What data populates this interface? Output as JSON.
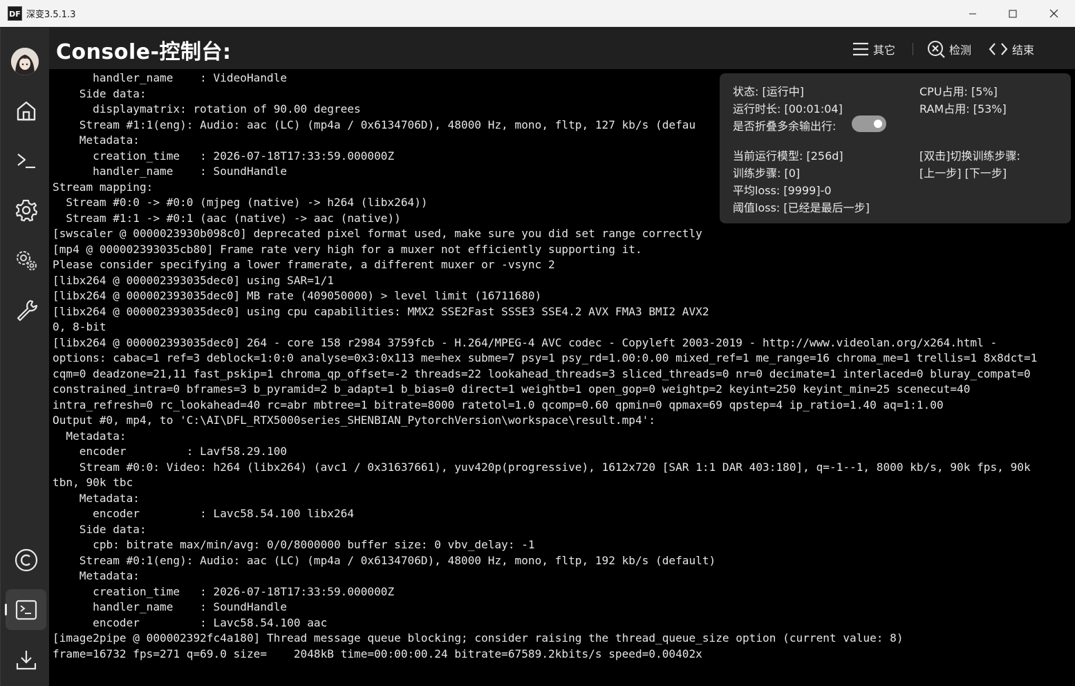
{
  "window": {
    "title": "深变3.5.1.3",
    "app_icon_text": "DF"
  },
  "sidebar": {
    "items": [
      {
        "name": "home-icon"
      },
      {
        "name": "terminal-prompt-icon"
      },
      {
        "name": "gear-icon"
      },
      {
        "name": "multi-gear-icon"
      },
      {
        "name": "wrench-icon"
      },
      {
        "name": "copyright-icon"
      },
      {
        "name": "console-icon",
        "active": true
      },
      {
        "name": "download-icon"
      }
    ]
  },
  "header": {
    "title": "Console-控制台:",
    "buttons": {
      "other": "其它",
      "detect": "检测",
      "end": "结束"
    }
  },
  "status_panel": {
    "state": "状态: [运行中]",
    "cpu": "CPU占用: [5%]",
    "runtime": "运行时长: [00:01:04]",
    "ram": "RAM占用: [53%]",
    "fold_label": "是否折叠多余输出行:",
    "fold_enabled": true,
    "model": "当前运行模型: [256d]",
    "switch_hint": "[双击]切换训练步骤:",
    "steps": "训练步骤: [0]",
    "step_nav": "[上一步] [下一步]",
    "avg_loss": "平均loss: [9999]-0",
    "threshold_loss": "阈值loss: [已经是最后一步]"
  },
  "console": {
    "lines": [
      "      handler_name    : VideoHandle",
      "    Side data:",
      "      displaymatrix: rotation of 90.00 degrees",
      "    Stream #1:1(eng): Audio: aac (LC) (mp4a / 0x6134706D), 48000 Hz, mono, fltp, 127 kb/s (defau",
      "    Metadata:",
      "      creation_time   : 2026-07-18T17:33:59.000000Z",
      "      handler_name    : SoundHandle",
      "Stream mapping:",
      "  Stream #0:0 -> #0:0 (mjpeg (native) -> h264 (libx264))",
      "  Stream #1:1 -> #0:1 (aac (native) -> aac (native))",
      "[swscaler @ 0000023930b098c0] deprecated pixel format used, make sure you did set range correctly",
      "[mp4 @ 000002393035cb80] Frame rate very high for a muxer not efficiently supporting it.",
      "Please consider specifying a lower framerate, a different muxer or -vsync 2",
      "[libx264 @ 000002393035dec0] using SAR=1/1",
      "[libx264 @ 000002393035dec0] MB rate (409050000) > level limit (16711680)",
      "[libx264 @ 000002393035dec0] using cpu capabilities: MMX2 SSE2Fast SSSE3 SSE4.2 AVX FMA3 BMI2 AVX2",
      "0, 8-bit",
      "[libx264 @ 000002393035dec0] 264 - core 158 r2984 3759fcb - H.264/MPEG-4 AVC codec - Copyleft 2003-2019 - http://www.videolan.org/x264.html -",
      "options: cabac=1 ref=3 deblock=1:0:0 analyse=0x3:0x113 me=hex subme=7 psy=1 psy_rd=1.00:0.00 mixed_ref=1 me_range=16 chroma_me=1 trellis=1 8x8dct=1",
      "cqm=0 deadzone=21,11 fast_pskip=1 chroma_qp_offset=-2 threads=22 lookahead_threads=3 sliced_threads=0 nr=0 decimate=1 interlaced=0 bluray_compat=0",
      "constrained_intra=0 bframes=3 b_pyramid=2 b_adapt=1 b_bias=0 direct=1 weightb=1 open_gop=0 weightp=2 keyint=250 keyint_min=25 scenecut=40",
      "intra_refresh=0 rc_lookahead=40 rc=abr mbtree=1 bitrate=8000 ratetol=1.0 qcomp=0.60 qpmin=0 qpmax=69 qpstep=4 ip_ratio=1.40 aq=1:1.00",
      "Output #0, mp4, to 'C:\\AI\\DFL_RTX5000series_SHENBIAN_PytorchVersion\\workspace\\result.mp4':",
      "  Metadata:",
      "    encoder         : Lavf58.29.100",
      "    Stream #0:0: Video: h264 (libx264) (avc1 / 0x31637661), yuv420p(progressive), 1612x720 [SAR 1:1 DAR 403:180], q=-1--1, 8000 kb/s, 90k fps, 90k",
      "tbn, 90k tbc",
      "    Metadata:",
      "      encoder         : Lavc58.54.100 libx264",
      "    Side data:",
      "      cpb: bitrate max/min/avg: 0/0/8000000 buffer size: 0 vbv_delay: -1",
      "    Stream #0:1(eng): Audio: aac (LC) (mp4a / 0x6134706D), 48000 Hz, mono, fltp, 192 kb/s (default)",
      "    Metadata:",
      "      creation_time   : 2026-07-18T17:33:59.000000Z",
      "      handler_name    : SoundHandle",
      "      encoder         : Lavc58.54.100 aac",
      "[image2pipe @ 000002392fc4a180] Thread message queue blocking; consider raising the thread_queue_size option (current value: 8)",
      "frame=16732 fps=271 q=69.0 size=    2048kB time=00:00:00.24 bitrate=67589.2kbits/s speed=0.00402x"
    ]
  }
}
